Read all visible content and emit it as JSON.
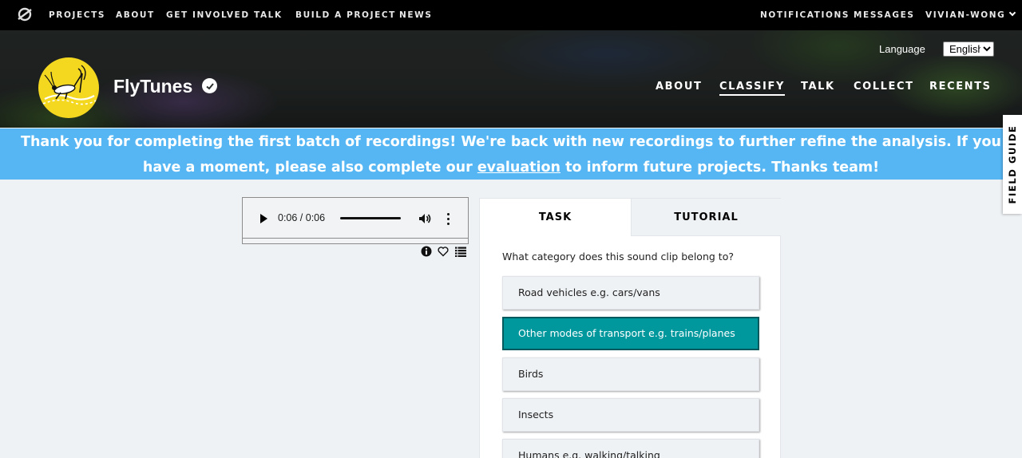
{
  "topnav": {
    "items": [
      "PROJECTS",
      "ABOUT",
      "GET INVOLVED",
      "TALK",
      "BUILD A PROJECT",
      "NEWS"
    ],
    "right": [
      "NOTIFICATIONS",
      "MESSAGES"
    ],
    "user": "VIVIAN-WONG"
  },
  "project": {
    "title": "FlyTunes",
    "language_label": "Language",
    "language_value": "English",
    "nav": [
      "ABOUT",
      "CLASSIFY",
      "TALK",
      "COLLECT",
      "RECENTS"
    ],
    "active_nav": "CLASSIFY"
  },
  "banner": {
    "line1": "Thank you for completing the first batch of recordings! We're back with new recordings to further refine the analysis. If you",
    "line2_before": "have a moment, please also complete our ",
    "link": "evaluation",
    "line2_after": " to inform future projects. Thanks team!"
  },
  "field_guide": "FIELD GUIDE",
  "audio": {
    "time": "0:06 / 0:06",
    "progress": 1.0
  },
  "task": {
    "tabs": [
      "TASK",
      "TUTORIAL"
    ],
    "question": "What category does this sound clip belong to?",
    "answers": [
      "Road vehicles e.g. cars/vans",
      "Other modes of transport e.g. trains/planes",
      "Birds",
      "Insects",
      "Humans e.g. walking/talking"
    ],
    "selected_index": 1
  },
  "colors": {
    "banner": "#56b6f4",
    "selected_answer": "#00979d",
    "avatar": "#f4d71f",
    "topnav": "#000000"
  }
}
